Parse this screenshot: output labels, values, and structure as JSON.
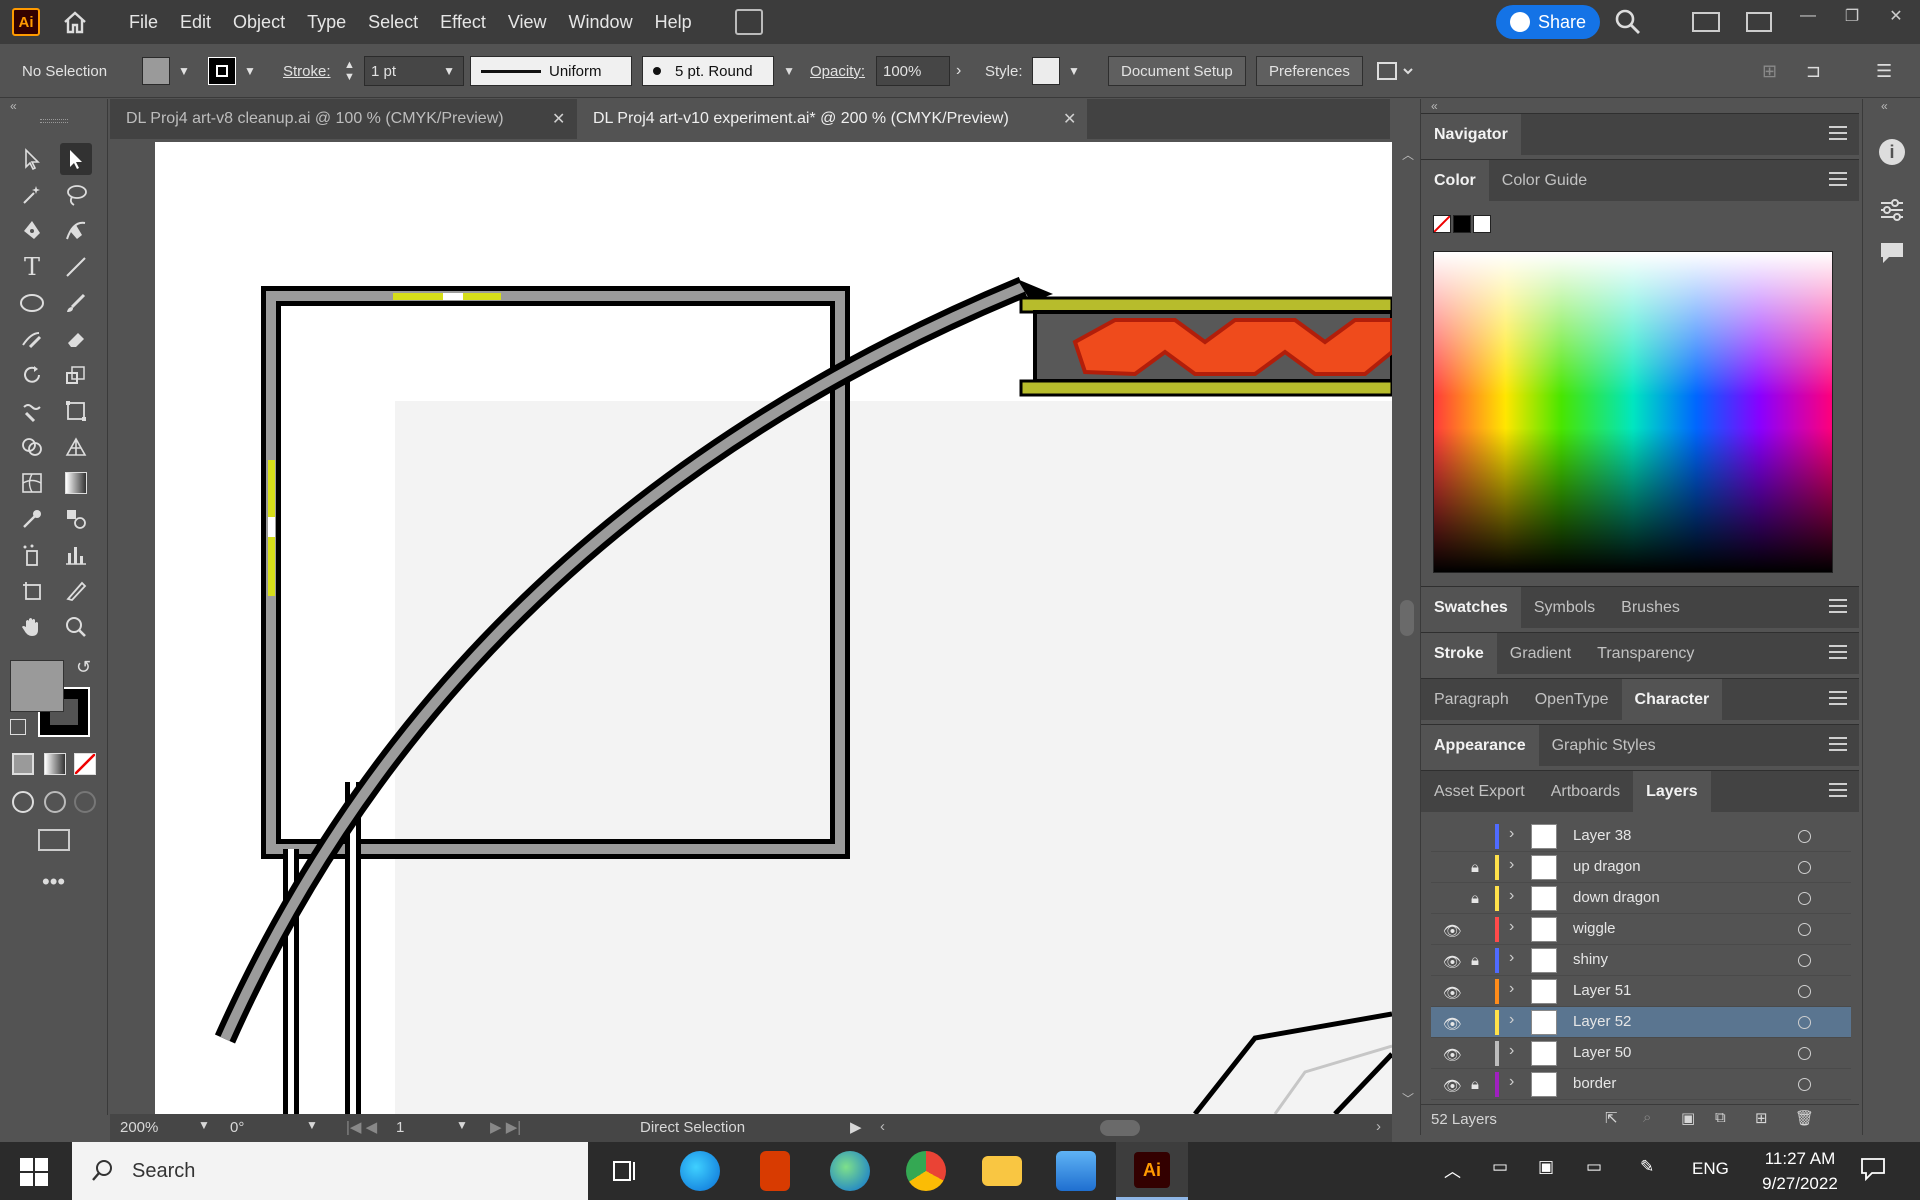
{
  "app": {
    "logo": "Ai"
  },
  "menu": [
    "File",
    "Edit",
    "Object",
    "Type",
    "Select",
    "Effect",
    "View",
    "Window",
    "Help"
  ],
  "share": {
    "label": "Share"
  },
  "controlbar": {
    "selection": "No Selection",
    "stroke_label": "Stroke:",
    "stroke_weight": "1 pt",
    "profile": "Uniform",
    "brush": "5 pt. Round",
    "opacity_label": "Opacity:",
    "opacity": "100%",
    "style_label": "Style:",
    "document_setup": "Document Setup",
    "preferences": "Preferences"
  },
  "tabs": [
    {
      "title": "DL Proj4 art-v8 cleanup.ai @ 100 % (CMYK/Preview)"
    },
    {
      "title": "DL Proj4 art-v10 experiment.ai* @ 200 % (CMYK/Preview)"
    }
  ],
  "statusbar": {
    "zoom": "200%",
    "rotate": "0°",
    "artboard": "1",
    "tool": "Direct Selection"
  },
  "panels": {
    "navigator": "Navigator",
    "color_tabs": [
      "Color",
      "Color Guide"
    ],
    "swatch_tabs": [
      "Swatches",
      "Symbols",
      "Brushes"
    ],
    "stroke_tabs": [
      "Stroke",
      "Gradient",
      "Transparency"
    ],
    "char_tabs": [
      "Paragraph",
      "OpenType",
      "Character"
    ],
    "appearance_tabs": [
      "Appearance",
      "Graphic Styles"
    ],
    "layers_tabs": [
      "Asset Export",
      "Artboards",
      "Layers"
    ],
    "layers_count": "52 Layers"
  },
  "layers": [
    {
      "name": "Layer 38",
      "visible": false,
      "locked": false,
      "color": "#4f6bff"
    },
    {
      "name": "up dragon",
      "visible": false,
      "locked": true,
      "color": "#ffe14a"
    },
    {
      "name": "down dragon",
      "visible": false,
      "locked": true,
      "color": "#ffe14a"
    },
    {
      "name": "wiggle",
      "visible": true,
      "locked": false,
      "color": "#ff4a4a"
    },
    {
      "name": "shiny",
      "visible": true,
      "locked": true,
      "color": "#4f6bff"
    },
    {
      "name": "Layer 51",
      "visible": true,
      "locked": false,
      "color": "#ff8c1a"
    },
    {
      "name": "Layer 52",
      "visible": true,
      "locked": false,
      "color": "#ffe14a",
      "active": true
    },
    {
      "name": "Layer 50",
      "visible": true,
      "locked": false,
      "color": "#bdbdbd"
    },
    {
      "name": "border",
      "visible": true,
      "locked": true,
      "color": "#a020c0"
    }
  ],
  "taskbar": {
    "search": "Search",
    "lang": "ENG",
    "time": "11:27 AM",
    "date": "9/27/2022"
  }
}
